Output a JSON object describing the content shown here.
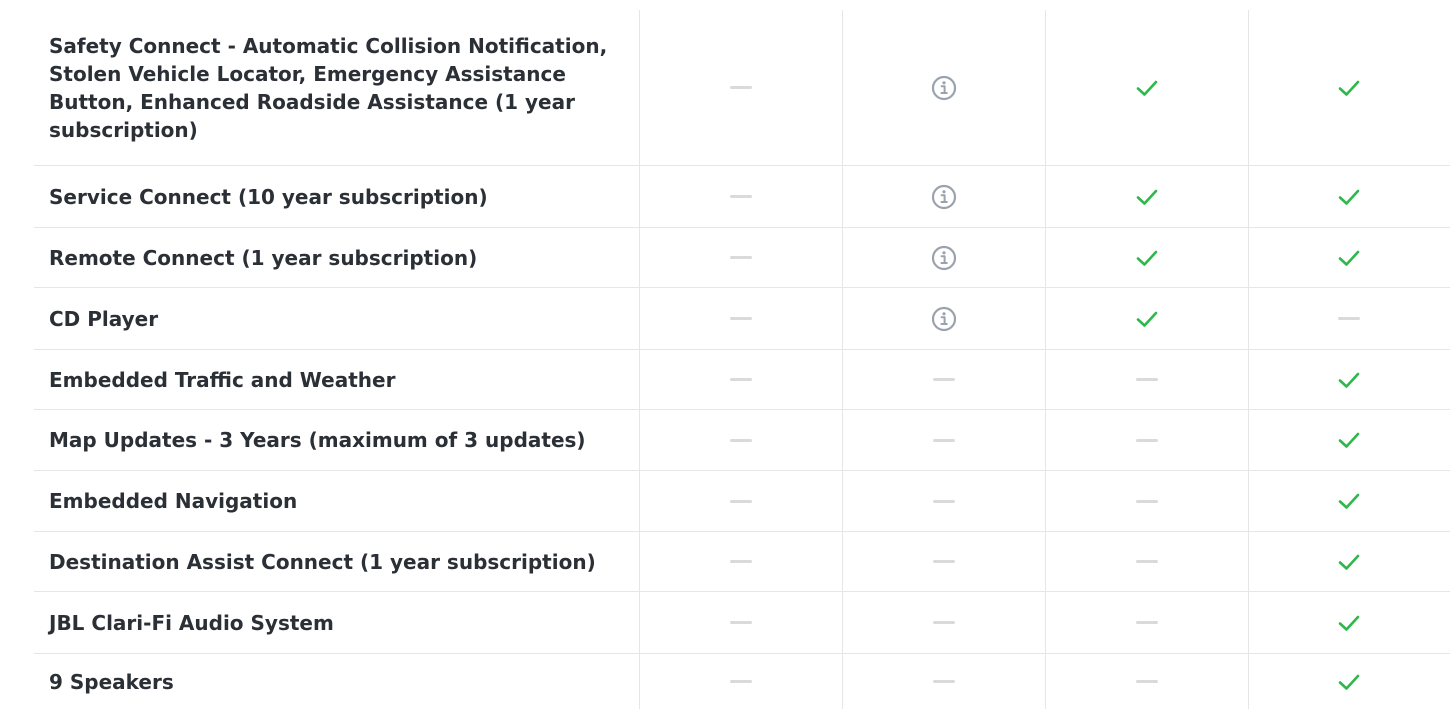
{
  "colors": {
    "check": "#2db84b",
    "info": "#9aa3ad",
    "dash": "#d9dadc",
    "divider": "#e6e6e6",
    "text": "#2b2f36"
  },
  "icons": {
    "check": "check-icon",
    "info": "info-icon",
    "dash": "dash-icon"
  },
  "rows": [
    {
      "label": "Safety Connect - Automatic Collision Notification, Stolen Vehicle Locator, Emergency Assistance Button, Enhanced Roadside Assistance (1 year subscription)",
      "cells": [
        "dash",
        "info",
        "check",
        "check"
      ]
    },
    {
      "label": "Service Connect (10 year subscription)",
      "cells": [
        "dash",
        "info",
        "check",
        "check"
      ]
    },
    {
      "label": "Remote Connect (1 year subscription)",
      "cells": [
        "dash",
        "info",
        "check",
        "check"
      ]
    },
    {
      "label": "CD Player",
      "cells": [
        "dash",
        "info",
        "check",
        "dash"
      ]
    },
    {
      "label": "Embedded Traffic and Weather",
      "cells": [
        "dash",
        "dash",
        "dash",
        "check"
      ]
    },
    {
      "label": "Map Updates - 3 Years (maximum of 3 updates)",
      "cells": [
        "dash",
        "dash",
        "dash",
        "check"
      ]
    },
    {
      "label": "Embedded Navigation",
      "cells": [
        "dash",
        "dash",
        "dash",
        "check"
      ]
    },
    {
      "label": "Destination Assist Connect (1 year subscription)",
      "cells": [
        "dash",
        "dash",
        "dash",
        "check"
      ]
    },
    {
      "label": "JBL Clari-Fi Audio System",
      "cells": [
        "dash",
        "dash",
        "dash",
        "check"
      ]
    },
    {
      "label": "9 Speakers",
      "cells": [
        "dash",
        "dash",
        "dash",
        "check"
      ]
    }
  ]
}
